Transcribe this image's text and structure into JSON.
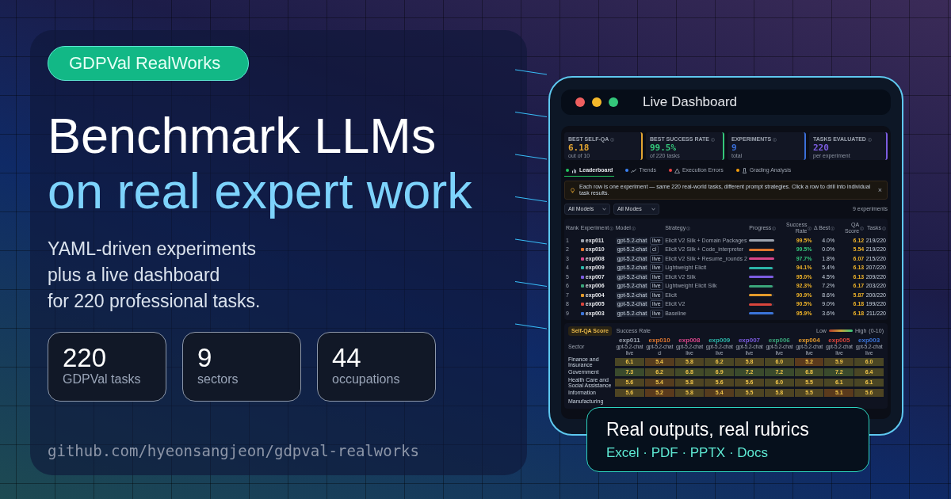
{
  "left": {
    "badge": "GDPVal RealWorks",
    "headline": [
      "Benchmark LLMs",
      "on real expert work"
    ],
    "subtitle": [
      "YAML-driven experiments",
      "plus a live dashboard",
      "for 220 professional tasks."
    ],
    "stats": [
      {
        "value": "220",
        "label": "GDPVal tasks"
      },
      {
        "value": "9",
        "label": "sectors"
      },
      {
        "value": "44",
        "label": "occupations"
      }
    ],
    "repo_url": "github.com/hyeonsangjeon/gdpval-realworks"
  },
  "window": {
    "title": "Live Dashboard"
  },
  "dashboard": {
    "stats": [
      {
        "label": "BEST SELF-QA",
        "value": "6.18",
        "note": "out of 10",
        "color": "#e3a531"
      },
      {
        "label": "BEST SUCCESS RATE",
        "value": "99.5%",
        "note": "of 220 tasks",
        "color": "#34c77b"
      },
      {
        "label": "EXPERIMENTS",
        "value": "9",
        "note": "total",
        "color": "#3b6fd9"
      },
      {
        "label": "TASKS EVALUATED",
        "value": "220",
        "note": "per experiment",
        "color": "#7c5ce0"
      }
    ],
    "tabs": [
      {
        "label": "Leaderboard",
        "selected": true,
        "color": "#22c55e"
      },
      {
        "label": "Trends",
        "selected": false,
        "color": "#3b82f6"
      },
      {
        "label": "Execution Errors",
        "selected": false,
        "color": "#ef4444"
      },
      {
        "label": "Grading Analysis",
        "selected": false,
        "color": "#f59e0b"
      }
    ],
    "notice": {
      "text": "Each row is one experiment — same 220 real-world tasks, different prompt strategies. Click a row to drill into individual task results.",
      "close": "×"
    },
    "filters": [
      "All Models",
      "All Modes"
    ],
    "count": "9 experiments",
    "table": {
      "columns": [
        "Rank",
        "Experiment",
        "Model",
        "Strategy",
        "Progress",
        "Success Rate",
        "Δ Best",
        "QA Score",
        "Tasks"
      ],
      "rows": [
        {
          "rank": "1",
          "experiment": "exp011",
          "color": "#9ca3af",
          "model": "gpt-5.2-chat",
          "mode": "live",
          "strategy": "Elicit V2 Silk + Domain Packages",
          "level": 0.995,
          "success_rate": "99.5%",
          "top": false,
          "delta_best": "4.0%",
          "qa_score": "6.12",
          "tasks": "219/220"
        },
        {
          "rank": "2",
          "experiment": "exp010",
          "color": "#e0772f",
          "model": "gpt-5.2-chat",
          "mode": "ci",
          "strategy": "Elicit V2 Silk + Code_interpreter",
          "level": 0.995,
          "success_rate": "99.5%",
          "top": true,
          "delta_best": "0.0%",
          "qa_score": "5.54",
          "tasks": "219/220"
        },
        {
          "rank": "3",
          "experiment": "exp008",
          "color": "#d9468a",
          "model": "gpt-5.2-chat",
          "mode": "live",
          "strategy": "Elicit V2 Silk + Resume_rounds 2",
          "level": 0.977,
          "success_rate": "97.7%",
          "top": true,
          "delta_best": "1.8%",
          "qa_score": "6.07",
          "tasks": "215/220"
        },
        {
          "rank": "4",
          "experiment": "exp009",
          "color": "#2bb5a8",
          "model": "gpt-5.2-chat",
          "mode": "live",
          "strategy": "Lightweight Elicit",
          "level": 0.941,
          "success_rate": "94.1%",
          "top": false,
          "delta_best": "5.4%",
          "qa_score": "6.13",
          "tasks": "207/220"
        },
        {
          "rank": "5",
          "experiment": "exp007",
          "color": "#7c5ce0",
          "model": "gpt-5.2-chat",
          "mode": "live",
          "strategy": "Elicit V2 Silk",
          "level": 0.95,
          "success_rate": "95.0%",
          "top": false,
          "delta_best": "4.5%",
          "qa_score": "6.13",
          "tasks": "209/220"
        },
        {
          "rank": "6",
          "experiment": "exp006",
          "color": "#3aa57a",
          "model": "gpt-5.2-chat",
          "mode": "live",
          "strategy": "Lightweight Elicit Silk",
          "level": 0.923,
          "success_rate": "92.3%",
          "top": false,
          "delta_best": "7.2%",
          "qa_score": "6.17",
          "tasks": "203/220"
        },
        {
          "rank": "7",
          "experiment": "exp004",
          "color": "#e39a2b",
          "model": "gpt-5.2-chat",
          "mode": "live",
          "strategy": "Elicit",
          "level": 0.909,
          "success_rate": "90.9%",
          "top": false,
          "delta_best": "8.6%",
          "qa_score": "5.87",
          "tasks": "200/220"
        },
        {
          "rank": "8",
          "experiment": "exp005",
          "color": "#d9453c",
          "model": "gpt-5.2-chat",
          "mode": "live",
          "strategy": "Elicit V2",
          "level": 0.905,
          "success_rate": "90.5%",
          "top": false,
          "delta_best": "9.0%",
          "qa_score": "6.18",
          "tasks": "199/220"
        },
        {
          "rank": "9",
          "experiment": "exp003",
          "color": "#3b74d9",
          "model": "gpt-5.2-chat",
          "mode": "live",
          "strategy": "Baseline",
          "level": 0.959,
          "success_rate": "95.9%",
          "top": false,
          "delta_best": "3.6%",
          "qa_score": "6.18",
          "tasks": "211/220"
        }
      ]
    },
    "heatmap": {
      "tabs": [
        {
          "label": "Self-QA Score",
          "selected": true
        },
        {
          "label": "Success Rate",
          "selected": false
        }
      ],
      "legend": {
        "low": "Low",
        "high": "High",
        "range": "(0-10)"
      },
      "corner": "Sector",
      "columns": [
        {
          "experiment": "exp011",
          "color": "#9ca3af",
          "model": "gpt-5.2-chat",
          "mode": "live"
        },
        {
          "experiment": "exp010",
          "color": "#e0772f",
          "model": "gpt-5.2-chat",
          "mode": "ci"
        },
        {
          "experiment": "exp008",
          "color": "#d9468a",
          "model": "gpt-5.2-chat",
          "mode": "live"
        },
        {
          "experiment": "exp009",
          "color": "#2bb5a8",
          "model": "gpt-5.2-chat",
          "mode": "live"
        },
        {
          "experiment": "exp007",
          "color": "#7c5ce0",
          "model": "gpt-5.2-chat",
          "mode": "live"
        },
        {
          "experiment": "exp006",
          "color": "#3aa57a",
          "model": "gpt-5.2-chat",
          "mode": "live"
        },
        {
          "experiment": "exp004",
          "color": "#e39a2b",
          "model": "gpt-5.2-chat",
          "mode": "live"
        },
        {
          "experiment": "exp005",
          "color": "#d9453c",
          "model": "gpt-5.2-chat",
          "mode": "live"
        },
        {
          "experiment": "exp003",
          "color": "#3b74d9",
          "model": "gpt-5.2-chat",
          "mode": "live"
        }
      ],
      "rows": [
        {
          "sector": "Finance and Insurance",
          "cells": [
            {
              "value": "6.1",
              "color": "#4a4624"
            },
            {
              "value": "5.4",
              "color": "#553c1e"
            },
            {
              "value": "5.8",
              "color": "#4e4422"
            },
            {
              "value": "6.2",
              "color": "#4a4624"
            },
            {
              "value": "5.8",
              "color": "#4e4422"
            },
            {
              "value": "6.0",
              "color": "#4a4624"
            },
            {
              "value": "5.2",
              "color": "#5a3a1c"
            },
            {
              "value": "5.9",
              "color": "#4e4422"
            },
            {
              "value": "6.0",
              "color": "#4a4624"
            }
          ]
        },
        {
          "sector": "Government",
          "cells": [
            {
              "value": "7.3",
              "color": "#3a4a2c"
            },
            {
              "value": "6.2",
              "color": "#4a4624"
            },
            {
              "value": "6.8",
              "color": "#424a28"
            },
            {
              "value": "6.9",
              "color": "#424a28"
            },
            {
              "value": "7.2",
              "color": "#3a4a2c"
            },
            {
              "value": "7.2",
              "color": "#3a4a2c"
            },
            {
              "value": "6.8",
              "color": "#424a28"
            },
            {
              "value": "7.2",
              "color": "#3a4a2c"
            },
            {
              "value": "6.4",
              "color": "#4a4624"
            }
          ]
        },
        {
          "sector": "Health Care and Social Assistance",
          "cells": [
            {
              "value": "5.6",
              "color": "#4e4422"
            },
            {
              "value": "5.4",
              "color": "#553c1e"
            },
            {
              "value": "5.8",
              "color": "#4e4422"
            },
            {
              "value": "5.6",
              "color": "#4e4422"
            },
            {
              "value": "5.6",
              "color": "#4e4422"
            },
            {
              "value": "6.0",
              "color": "#4a4624"
            },
            {
              "value": "5.5",
              "color": "#4e4422"
            },
            {
              "value": "6.1",
              "color": "#4a4624"
            },
            {
              "value": "6.1",
              "color": "#4a4624"
            }
          ]
        },
        {
          "sector": "Information",
          "cells": [
            {
              "value": "5.6",
              "color": "#4e4422"
            },
            {
              "value": "5.2",
              "color": "#5a3a1c"
            },
            {
              "value": "5.8",
              "color": "#4e4422"
            },
            {
              "value": "5.4",
              "color": "#553c1e"
            },
            {
              "value": "5.5",
              "color": "#4e4422"
            },
            {
              "value": "5.8",
              "color": "#4e4422"
            },
            {
              "value": "5.5",
              "color": "#4e4422"
            },
            {
              "value": "5.1",
              "color": "#5a3a1c"
            },
            {
              "value": "5.6",
              "color": "#4e4422"
            }
          ]
        },
        {
          "sector": "Manufacturing"
        }
      ]
    }
  },
  "callout": {
    "title": "Real outputs, real rubrics",
    "formats": "Excel · PDF · PPTX · Docs"
  }
}
